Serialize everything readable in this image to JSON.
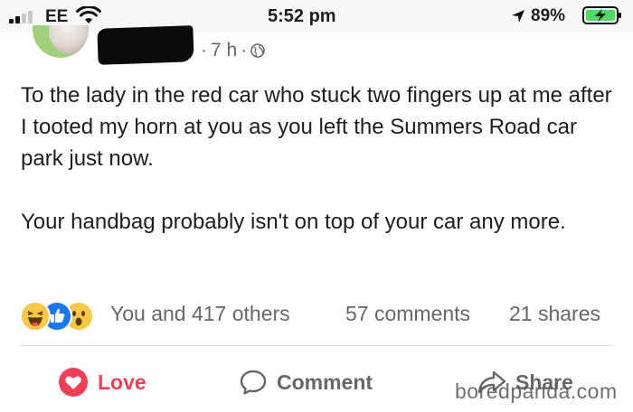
{
  "status_bar": {
    "carrier": "EE",
    "time": "5:52 pm",
    "battery_percent": "89%",
    "icons": [
      "signal-icon",
      "wifi-icon",
      "location-arrow-icon",
      "battery-charging-icon"
    ]
  },
  "post": {
    "age": "7 h",
    "separator": "·",
    "privacy_icon": "globe-icon",
    "paragraphs": [
      "To the lady in the red car who stuck two fingers up at me after I tooted my horn at you as you left the Summers Road car park just now.",
      "Your handbag probably isn't on top of your car any more."
    ]
  },
  "engagement": {
    "reactions": [
      "haha",
      "like",
      "wow"
    ],
    "summary": "You and 417 others",
    "comments": "57 comments",
    "shares": "21 shares"
  },
  "actions": {
    "love_label": "Love",
    "comment_label": "Comment",
    "share_label": "Share"
  },
  "watermark": "boredpanda.com",
  "colors": {
    "love": "#f33e58",
    "like": "#1877f2",
    "muted_text": "#65676b",
    "text": "#1c1e21"
  }
}
